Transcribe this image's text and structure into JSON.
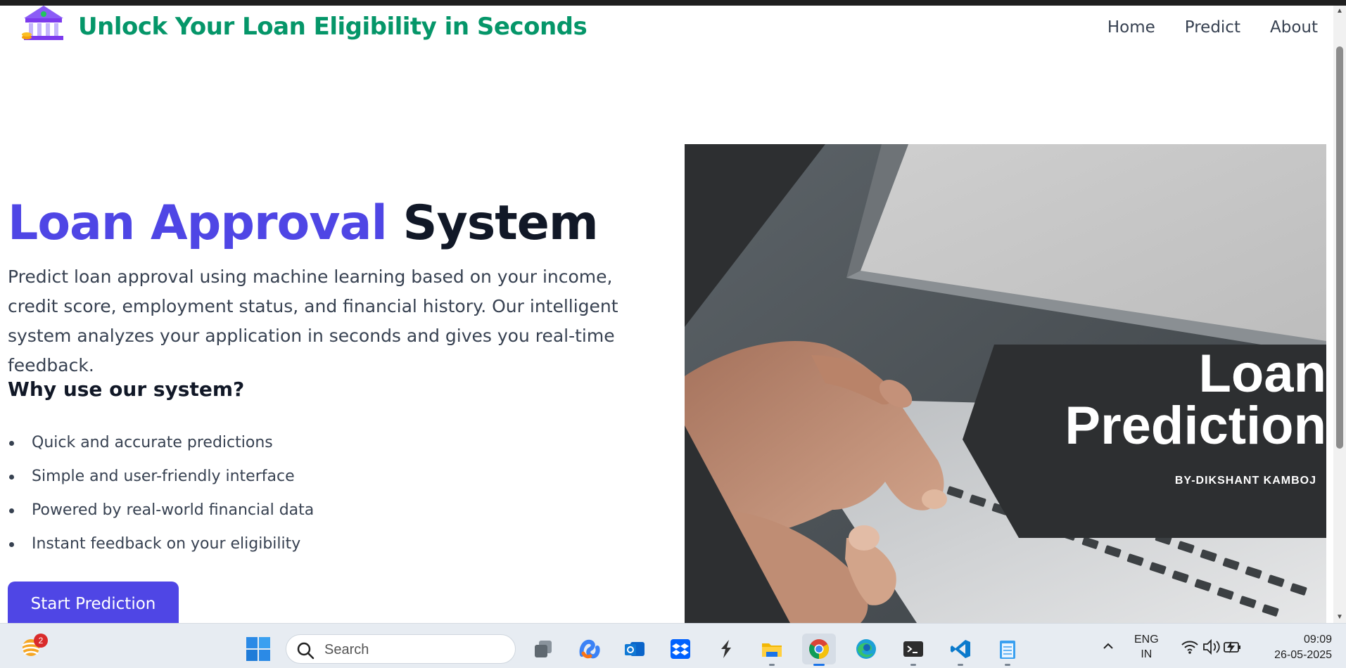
{
  "header": {
    "brand": "Unlock Your Loan Eligibility in Seconds",
    "logo_icon": "bank-building-icon",
    "nav": [
      {
        "label": "Home"
      },
      {
        "label": "Predict"
      },
      {
        "label": "About"
      }
    ]
  },
  "hero": {
    "title_accent": "Loan Approval",
    "title_rest": "System",
    "description": "Predict loan approval using machine learning based on your income, credit score, employment status, and financial history. Our intelligent system analyzes your application in seconds and gives you real-time feedback.",
    "why_heading": "Why use our system?",
    "features": [
      "Quick and accurate predictions",
      "Simple and user-friendly interface",
      "Powered by real-world financial data",
      "Instant feedback on your eligibility"
    ],
    "cta_label": "Start Prediction"
  },
  "hero_image": {
    "title_line1": "Loan",
    "title_line2": "Prediction",
    "byline": "BY-DIKSHANT KAMBOJ"
  },
  "colors": {
    "brand_green": "#059669",
    "accent_indigo": "#4f46e5",
    "heading_dark": "#111827",
    "body_text": "#374151"
  },
  "taskbar": {
    "weather_badge": "2",
    "search_placeholder": "Search",
    "apps": [
      "task-view-icon",
      "copilot-icon",
      "outlook-icon",
      "dropbox-icon",
      "sublime-text-icon",
      "file-explorer-icon",
      "chrome-icon",
      "edge-icon",
      "terminal-icon",
      "vscode-icon",
      "notepad-icon"
    ],
    "active_app": "chrome-icon",
    "lang_line1": "ENG",
    "lang_line2": "IN",
    "time": "09:09",
    "date": "26-05-2025"
  }
}
